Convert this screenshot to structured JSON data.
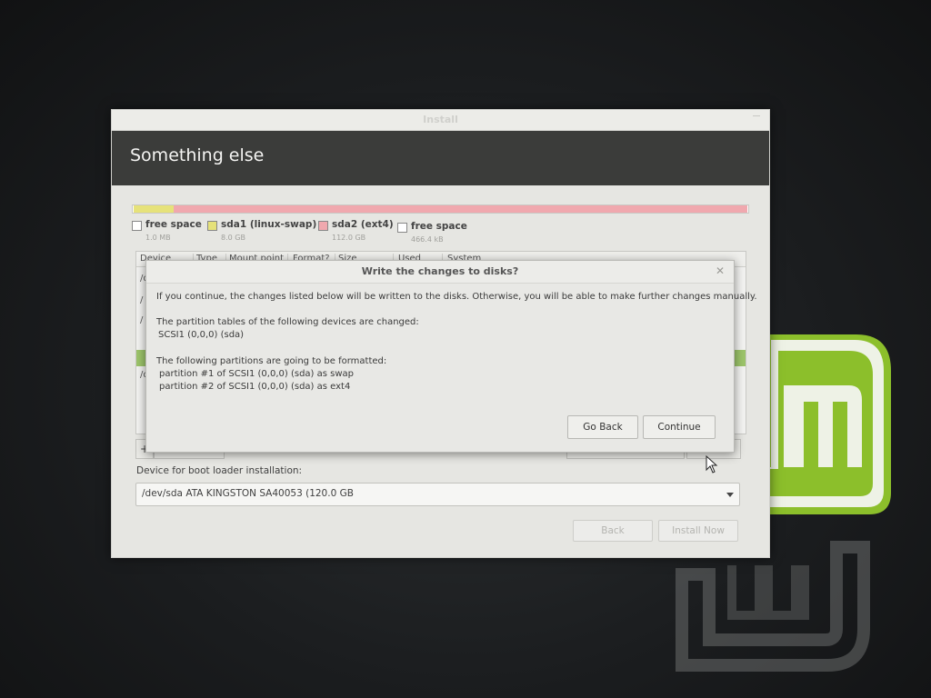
{
  "window": {
    "title": "Install"
  },
  "page": {
    "heading": "Something else"
  },
  "partition_bar": {
    "segments": [
      {
        "name": "free space",
        "fraction": 0.001,
        "color": "#ffffff"
      },
      {
        "name": "sda1 (linux-swap)",
        "fraction": 0.066,
        "color": "#e6e27a"
      },
      {
        "name": "sda2 (ext4)",
        "fraction": 0.933,
        "color": "#f0a8ae"
      },
      {
        "name": "free space",
        "fraction": 0.0001,
        "color": "#ffffff"
      }
    ]
  },
  "legend": [
    {
      "label": "free space",
      "size": "1.0 MB",
      "color": "#ffffff"
    },
    {
      "label": "sda1 (linux-swap)",
      "size": "8.0 GB",
      "color": "#e6e27a"
    },
    {
      "label": "sda2 (ext4)",
      "size": "112.0 GB",
      "color": "#f0a8ae"
    },
    {
      "label": "free space",
      "size": "466.4 kB",
      "color": "#ffffff"
    }
  ],
  "table": {
    "columns": [
      "Device",
      "Type",
      "Mount point",
      "Format?",
      "Size",
      "Used",
      "System"
    ],
    "row_fragments": [
      "/d",
      "/",
      "/",
      "/d"
    ]
  },
  "toolbar": {
    "add_label": "+"
  },
  "boot_loader": {
    "label": "Device for boot loader installation:",
    "selected": "/dev/sda   ATA KINGSTON SA40053 (120.0 GB"
  },
  "buttons": {
    "back": "Back",
    "install_now": "Install Now"
  },
  "dialog": {
    "title": "Write the changes to disks?",
    "close_glyph": "✕",
    "intro": "If you continue, the changes listed below will be written to the disks. Otherwise, you will be able to make further changes manually.",
    "partition_tables_heading": "The partition tables of the following devices are changed:",
    "partition_tables": [
      "SCSI1 (0,0,0) (sda)"
    ],
    "formatted_heading": "The following partitions are going to be formatted:",
    "formatted": [
      "partition #1 of SCSI1 (0,0,0) (sda) as swap",
      "partition #2 of SCSI1 (0,0,0) (sda) as ext4"
    ],
    "go_back": "Go Back",
    "continue": "Continue"
  },
  "colors": {
    "accent": "#8cc63f",
    "header_bg": "#3b3c3a"
  }
}
